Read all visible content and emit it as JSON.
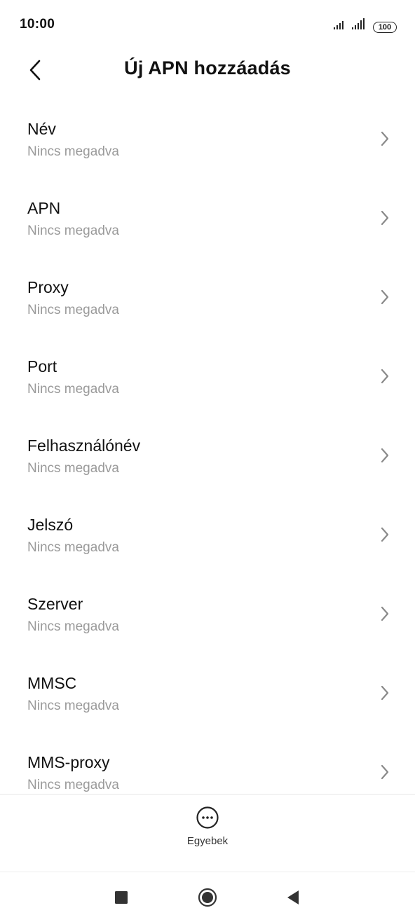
{
  "status_bar": {
    "time": "10:00",
    "battery": "100",
    "icons": [
      "signal-icon",
      "signal-icon",
      "battery-icon"
    ]
  },
  "header": {
    "title": "Új APN hozzáadás",
    "back_icon": "back-arrow-icon"
  },
  "fields": [
    {
      "label": "Név",
      "value": "Nincs megadva"
    },
    {
      "label": "APN",
      "value": "Nincs megadva"
    },
    {
      "label": "Proxy",
      "value": "Nincs megadva"
    },
    {
      "label": "Port",
      "value": "Nincs megadva"
    },
    {
      "label": "Felhasználónév",
      "value": "Nincs megadva"
    },
    {
      "label": "Jelszó",
      "value": "Nincs megadva"
    },
    {
      "label": "Szerver",
      "value": "Nincs megadva"
    },
    {
      "label": "MMSC",
      "value": "Nincs megadva"
    },
    {
      "label": "MMS-proxy",
      "value": "Nincs megadva"
    }
  ],
  "footer": {
    "more_label": "Egyebek",
    "more_icon": "more-icon"
  },
  "nav_bar": {
    "icons": [
      "recent-apps-icon",
      "home-icon",
      "back-icon"
    ]
  }
}
